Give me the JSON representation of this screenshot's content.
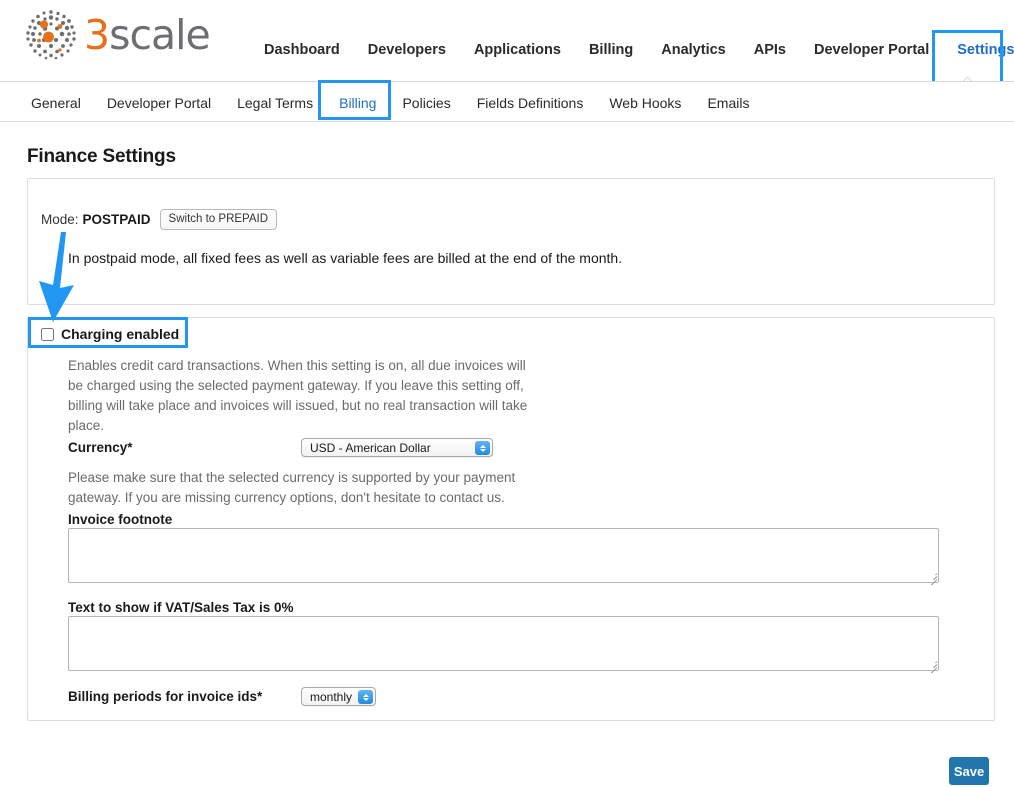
{
  "brand": {
    "logo_icon": "3scale-dots-logo-icon",
    "name_three": "3",
    "name_rest": "scale"
  },
  "main_nav": {
    "items": [
      {
        "label": "Dashboard",
        "active": false
      },
      {
        "label": "Developers",
        "active": false
      },
      {
        "label": "Applications",
        "active": false
      },
      {
        "label": "Billing",
        "active": false
      },
      {
        "label": "Analytics",
        "active": false
      },
      {
        "label": "APIs",
        "active": false
      },
      {
        "label": "Developer Portal",
        "active": false
      },
      {
        "label": "Settings",
        "active": true
      }
    ],
    "highlight_color": "#2196f3"
  },
  "sub_nav": {
    "items": [
      {
        "label": "General",
        "active": false
      },
      {
        "label": "Developer Portal",
        "active": false
      },
      {
        "label": "Legal Terms",
        "active": false
      },
      {
        "label": "Billing",
        "active": true
      },
      {
        "label": "Policies",
        "active": false
      },
      {
        "label": "Fields Definitions",
        "active": false
      },
      {
        "label": "Web Hooks",
        "active": false
      },
      {
        "label": "Emails",
        "active": false
      }
    ],
    "highlight_color": "#2196f3"
  },
  "page": {
    "title": "Finance Settings"
  },
  "mode_panel": {
    "mode_label": "Mode:",
    "mode_value": "POSTPAID",
    "switch_button": "Switch to PREPAID",
    "description": "In postpaid mode, all fixed fees as well as variable fees are billed at the end of the month."
  },
  "form_panel": {
    "charging": {
      "label": "Charging enabled",
      "checked": false,
      "help": "Enables credit card transactions. When this setting is on, all due invoices will be charged using the selected payment gateway. If you leave this setting off, billing will take place and invoices will issued, but no real transaction will take place."
    },
    "currency": {
      "label": "Currency*",
      "value": "USD - American Dollar",
      "help": "Please make sure that the selected currency is supported by your payment gateway. If you are missing currency options, don't hesitate to contact us."
    },
    "invoice_footnote": {
      "label": "Invoice footnote",
      "value": "",
      "placeholder": ""
    },
    "vat_text": {
      "label": "Text to show if VAT/Sales Tax is 0%",
      "value": "",
      "placeholder": ""
    },
    "billing_periods": {
      "label": "Billing periods for invoice ids*",
      "value": "monthly"
    }
  },
  "actions": {
    "save_label": "Save",
    "save_color": "#2176ae"
  },
  "annotation": {
    "arrow_color": "#2196f3",
    "arrow_target": "charging-enabled-checkbox"
  }
}
